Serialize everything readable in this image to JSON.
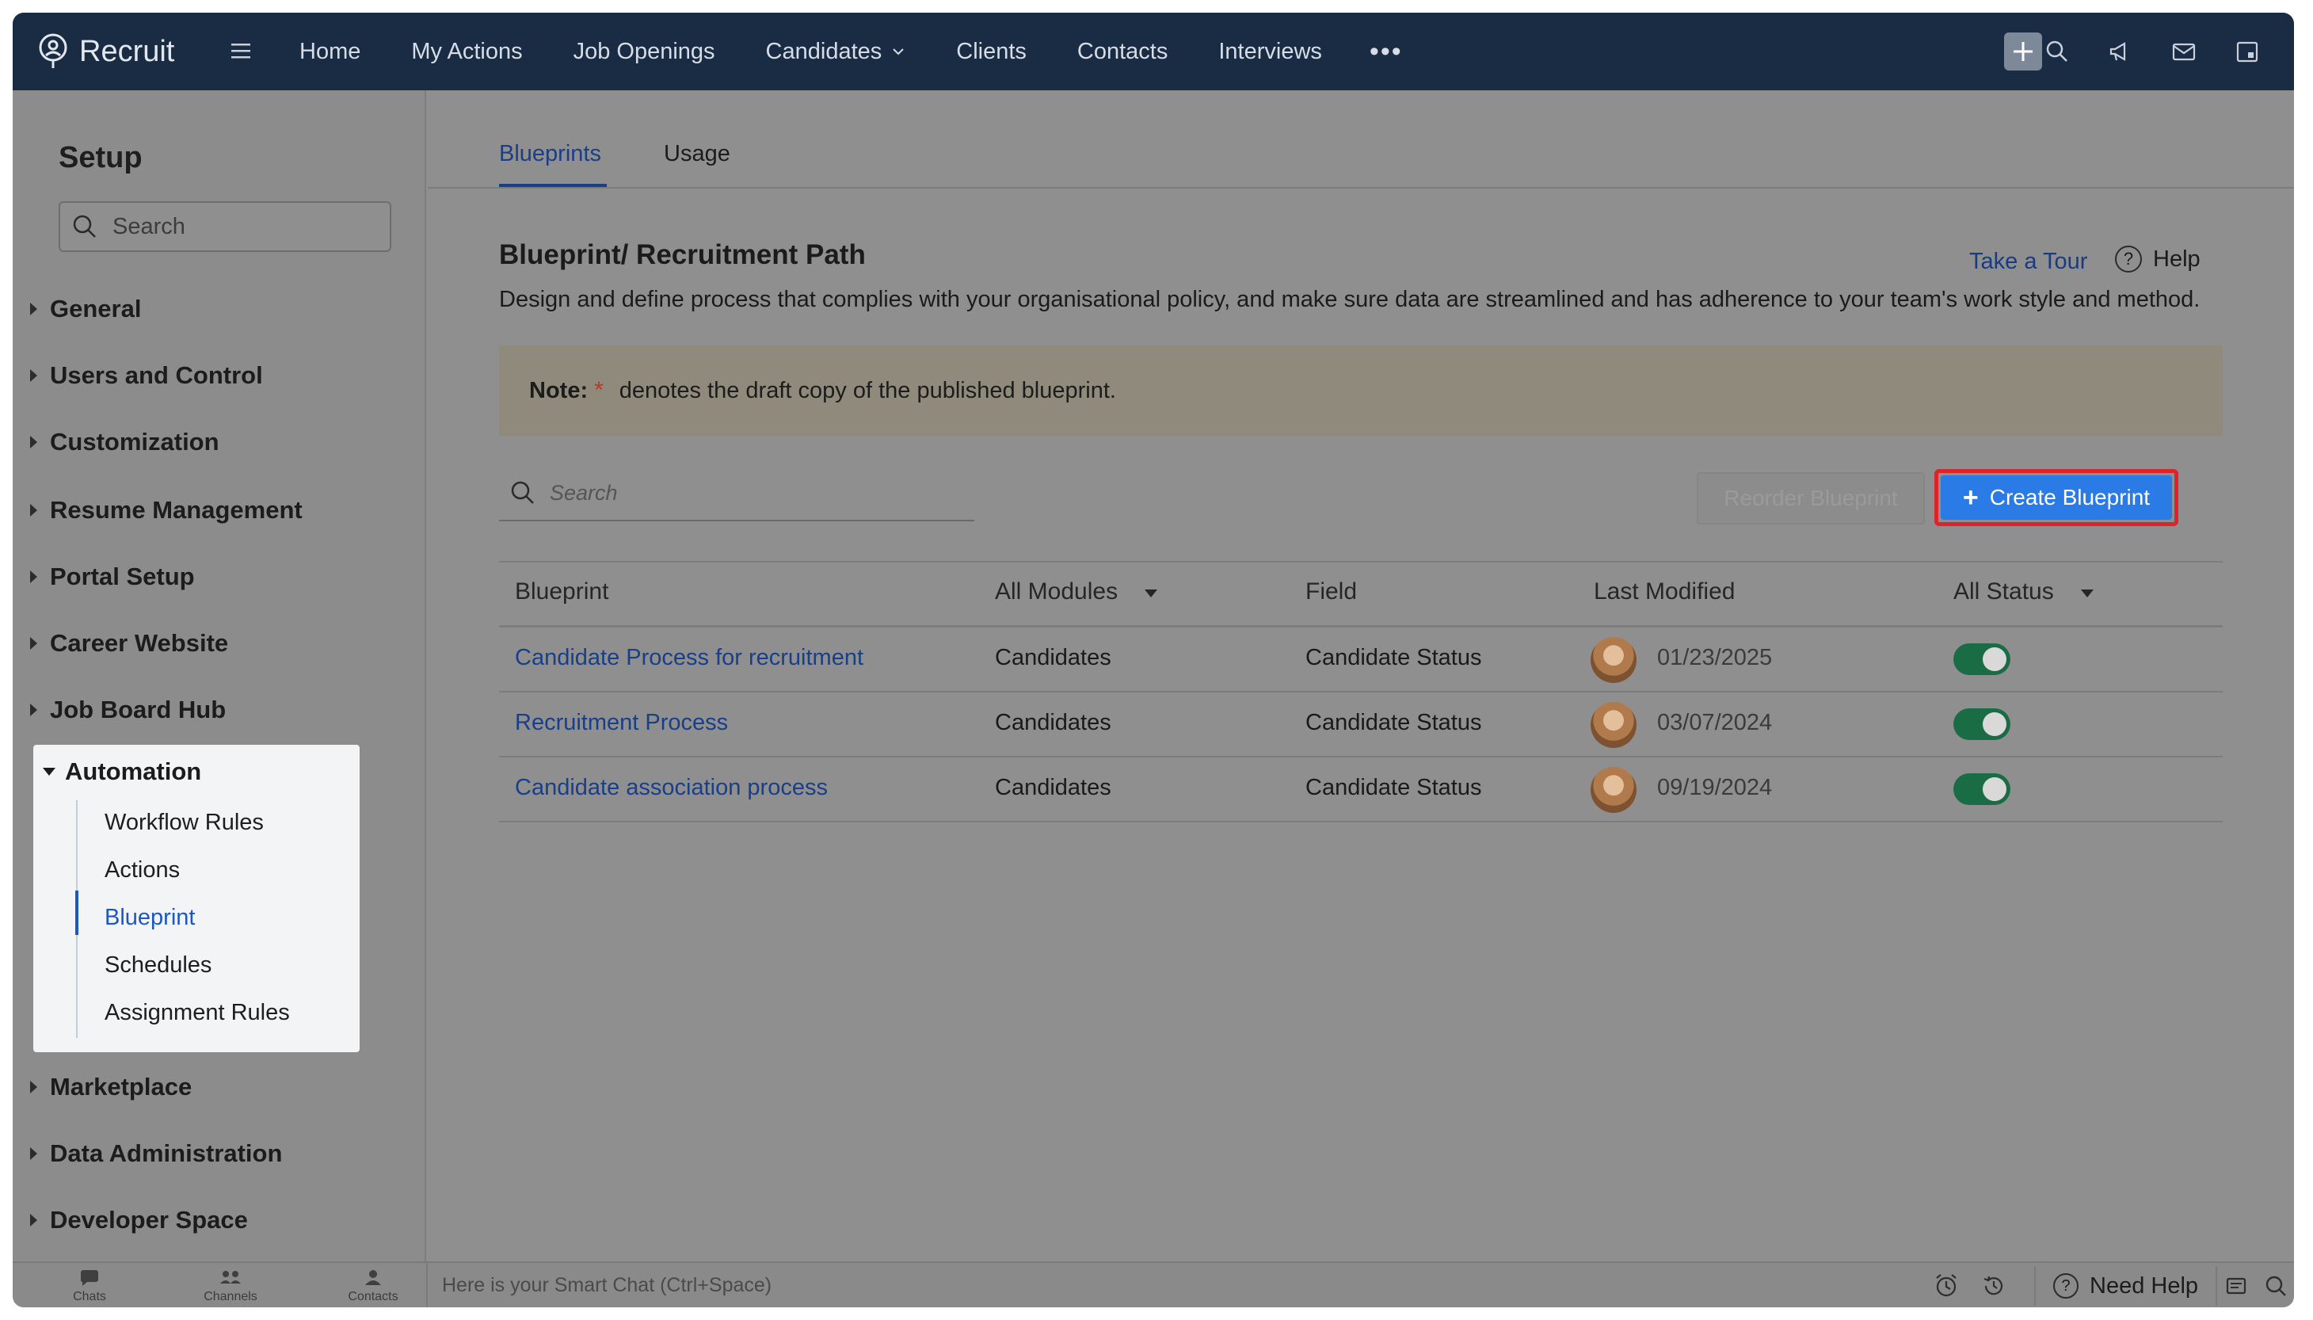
{
  "brand": {
    "name": "Recruit"
  },
  "nav": {
    "items": [
      {
        "label": "Home"
      },
      {
        "label": "My Actions"
      },
      {
        "label": "Job Openings"
      },
      {
        "label": "Candidates",
        "dropdown": true
      },
      {
        "label": "Clients"
      },
      {
        "label": "Contacts"
      },
      {
        "label": "Interviews"
      }
    ],
    "more": "•••",
    "icons": [
      "plus-icon",
      "search-icon",
      "megaphone-icon",
      "mail-icon",
      "calendar-icon",
      "bell-icon",
      "gear-icon",
      "avatar",
      "apps-grid-icon"
    ]
  },
  "sidebar": {
    "title": "Setup",
    "search_placeholder": "Search",
    "items": [
      {
        "label": "General"
      },
      {
        "label": "Users and Control"
      },
      {
        "label": "Customization"
      },
      {
        "label": "Resume Management"
      },
      {
        "label": "Portal Setup"
      },
      {
        "label": "Career Website"
      },
      {
        "label": "Job Board Hub"
      }
    ],
    "automation": {
      "label": "Automation",
      "children": [
        {
          "label": "Workflow Rules"
        },
        {
          "label": "Actions"
        },
        {
          "label": "Blueprint",
          "active": true
        },
        {
          "label": "Schedules"
        },
        {
          "label": "Assignment Rules"
        }
      ]
    },
    "items_after": [
      {
        "label": "Marketplace"
      },
      {
        "label": "Data Administration"
      },
      {
        "label": "Developer Space"
      }
    ]
  },
  "tabs": [
    {
      "label": "Blueprints",
      "active": true
    },
    {
      "label": "Usage"
    }
  ],
  "page": {
    "title": "Blueprint/ Recruitment Path",
    "take_tour": "Take a Tour",
    "help": "Help",
    "description": "Design and define process that complies with your organisational policy, and make sure data are streamlined and has adherence to your team's work style and method.",
    "note_label": "Note:",
    "note_star": "*",
    "note_text": "denotes the draft copy of the published blueprint."
  },
  "toolbar": {
    "search_placeholder": "Search",
    "reorder_label": "Reorder Blueprint",
    "create_label": "Create Blueprint"
  },
  "table": {
    "headers": {
      "blueprint": "Blueprint",
      "modules": "All Modules",
      "field": "Field",
      "last_modified": "Last Modified",
      "status": "All Status"
    },
    "rows": [
      {
        "name": "Candidate Process for recruitment",
        "module": "Candidates",
        "field": "Candidate Status",
        "date": "01/23/2025",
        "enabled": true
      },
      {
        "name": "Recruitment Process",
        "module": "Candidates",
        "field": "Candidate Status",
        "date": "03/07/2024",
        "enabled": true
      },
      {
        "name": "Candidate association process",
        "module": "Candidates",
        "field": "Candidate Status",
        "date": "09/19/2024",
        "enabled": true
      }
    ]
  },
  "bottom": {
    "tabs": [
      {
        "label": "Chats"
      },
      {
        "label": "Channels"
      },
      {
        "label": "Contacts"
      }
    ],
    "smart_chat": "Here is your Smart Chat (Ctrl+Space)",
    "need_help": "Need Help"
  },
  "colors": {
    "nav_bg": "#1a2b44",
    "accent_blue": "#2a7be6",
    "link_blue": "#183f88",
    "highlight_red": "#e0232b",
    "toggle_on": "#1a6c45"
  }
}
